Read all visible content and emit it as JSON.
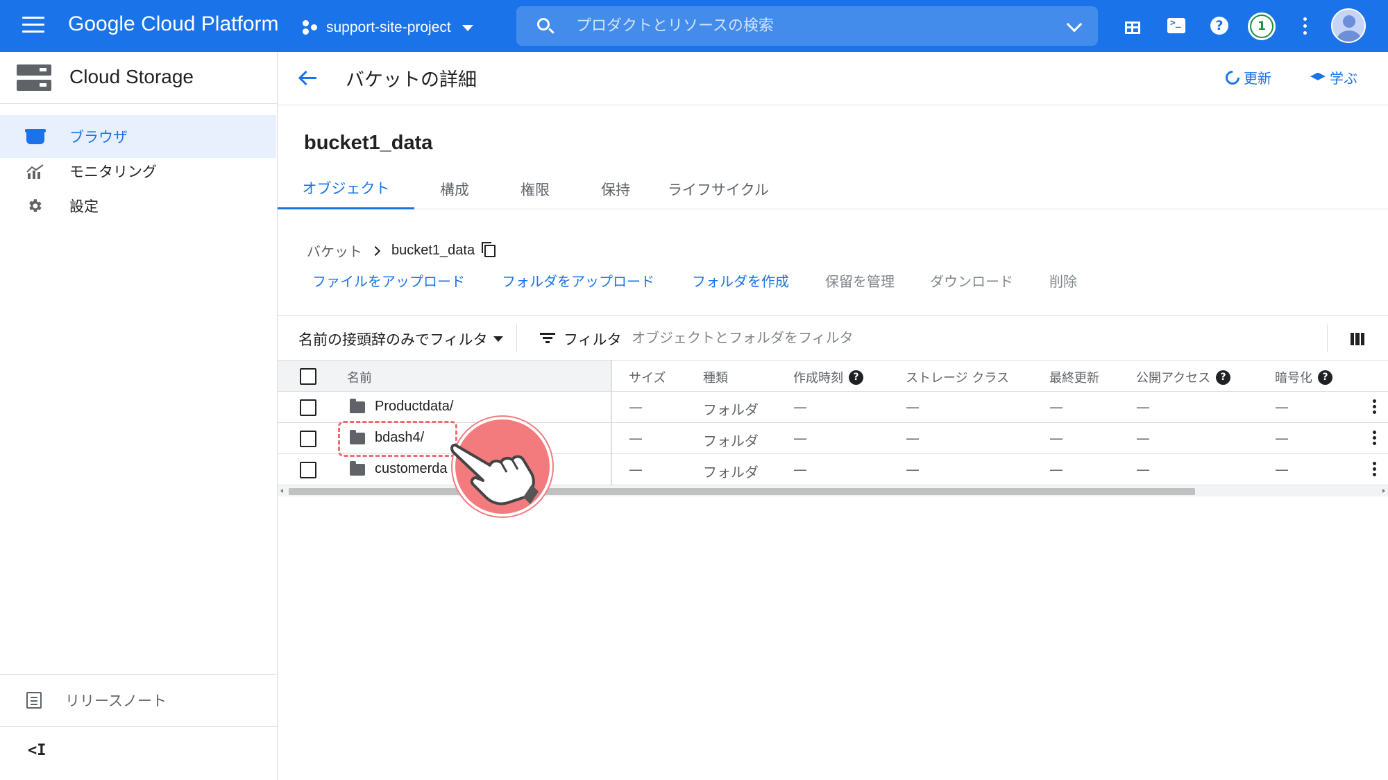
{
  "topbar": {
    "app_title": "Google Cloud Platform",
    "project": "support-site-project",
    "search_placeholder": "プロダクトとリソースの検索",
    "notification_count": "1"
  },
  "sidebar": {
    "title": "Cloud Storage",
    "items": [
      {
        "label": "ブラウザ",
        "icon": "shopping-bag-icon",
        "active": true
      },
      {
        "label": "モニタリング",
        "icon": "monitoring-chart-icon",
        "active": false
      },
      {
        "label": "設定",
        "icon": "gear-icon",
        "active": false
      }
    ],
    "release_notes": "リリースノート",
    "collapse": "<I"
  },
  "header": {
    "title": "バケットの詳細",
    "refresh_label": "更新",
    "learn_label": "学ぶ"
  },
  "bucket": {
    "name": "bucket1_data",
    "tabs": [
      "オブジェクト",
      "構成",
      "権限",
      "保持",
      "ライフサイクル"
    ],
    "active_tab": "オブジェクト"
  },
  "breadcrumb": {
    "root": "バケット",
    "current": "bucket1_data"
  },
  "actions": {
    "upload_files": "ファイルをアップロード",
    "upload_folder": "フォルダをアップロード",
    "create_folder": "フォルダを作成",
    "manage_holds": "保留を管理",
    "download": "ダウンロード",
    "delete": "削除"
  },
  "filter": {
    "prefix_filter": "名前の接頭辞のみでフィルタ",
    "label": "フィルタ",
    "placeholder": "オブジェクトとフォルダをフィルタ"
  },
  "table": {
    "columns": [
      "名前",
      "サイズ",
      "種類",
      "作成時刻",
      "ストレージ クラス",
      "最終更新",
      "公開アクセス",
      "暗号化"
    ],
    "rows": [
      {
        "name": "Productdata/",
        "size": "—",
        "type": "フォルダ",
        "created": "—",
        "storage_class": "—",
        "updated": "—",
        "public": "—",
        "encryption": "—"
      },
      {
        "name": "bdash4/",
        "size": "—",
        "type": "フォルダ",
        "created": "—",
        "storage_class": "—",
        "updated": "—",
        "public": "—",
        "encryption": "—"
      },
      {
        "name": "customerda",
        "size": "—",
        "type": "フォルダ",
        "created": "—",
        "storage_class": "—",
        "updated": "—",
        "public": "—",
        "encryption": "—"
      }
    ]
  },
  "colors": {
    "primary": "#1a73e8",
    "highlight": "#f37b7e"
  }
}
